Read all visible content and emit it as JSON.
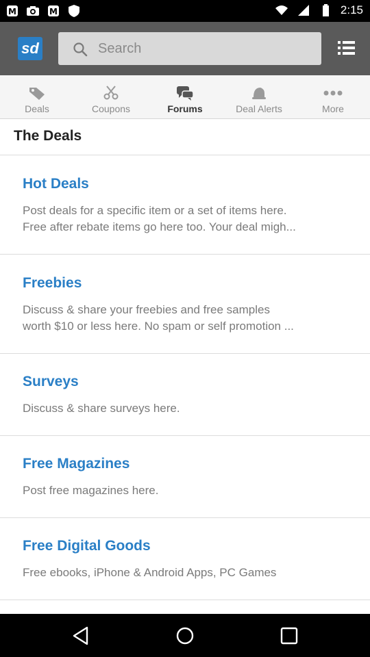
{
  "status_bar": {
    "time": "2:15",
    "left_icons": [
      "app-notification-icon",
      "camera-icon",
      "app-notification-icon",
      "shield-icon"
    ],
    "right_icons": [
      "wifi-icon",
      "signal-icon",
      "battery-icon"
    ]
  },
  "header": {
    "logo_text": "sd",
    "search_placeholder": "Search",
    "menu_icon": "list-menu-icon"
  },
  "tabs": [
    {
      "label": "Deals",
      "icon": "tag-icon",
      "active": false
    },
    {
      "label": "Coupons",
      "icon": "scissors-icon",
      "active": false
    },
    {
      "label": "Forums",
      "icon": "chat-bubbles-icon",
      "active": true
    },
    {
      "label": "Deal Alerts",
      "icon": "bell-icon",
      "active": false
    },
    {
      "label": "More",
      "icon": "more-dots-icon",
      "active": false
    }
  ],
  "section_title": "The Deals",
  "forums": [
    {
      "title": "Hot Deals",
      "description": "Post deals for a specific item or a set of items here.\nFree after rebate items go here too. Your deal migh..."
    },
    {
      "title": "Freebies",
      "description": "Discuss & share your freebies and free samples\nworth $10 or less here. No spam or self promotion ..."
    },
    {
      "title": "Surveys",
      "description": "Discuss & share surveys here."
    },
    {
      "title": "Free Magazines",
      "description": "Post free magazines here."
    },
    {
      "title": "Free Digital Goods",
      "description": "Free ebooks, iPhone & Android Apps, PC Games"
    }
  ],
  "nav_bar": [
    "back-icon",
    "home-icon",
    "recent-apps-icon"
  ],
  "colors": {
    "accent": "#2a7fc6",
    "appbar": "#5a5a5a",
    "tabbar": "#f5f5f5"
  }
}
